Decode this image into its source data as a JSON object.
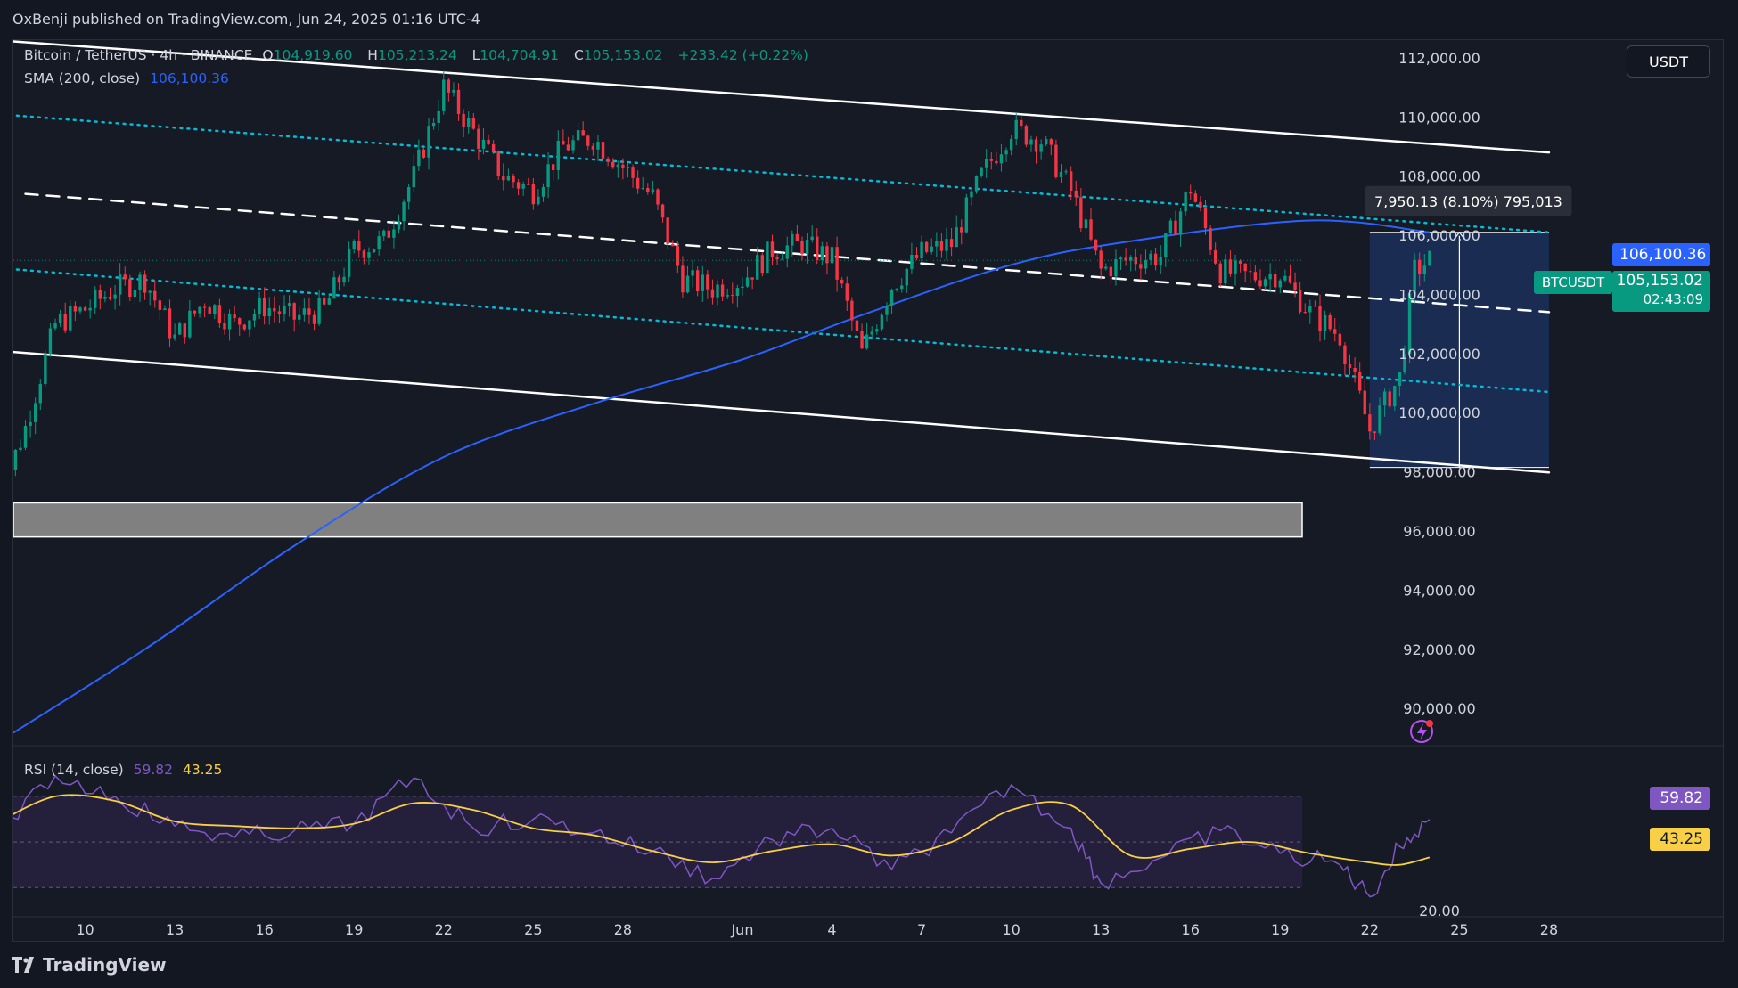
{
  "header": {
    "publisher": "OxBenji published on TradingView.com, Jun 24, 2025 01:16 UTC-4"
  },
  "legend": {
    "symbol": "Bitcoin / TetherUS · 4h · BINANCE",
    "o_label": "O",
    "o_value": "104,919.60",
    "h_label": "H",
    "h_value": "105,213.24",
    "l_label": "L",
    "l_value": "104,704.91",
    "c_label": "C",
    "c_value": "105,153.02",
    "change": "+233.42 (+0.22%)",
    "sma_label": "SMA (200, close)",
    "sma_value": "106,100.36"
  },
  "rsi_legend": {
    "label": "RSI (14, close)",
    "rsi_value": "59.82",
    "ma_value": "43.25"
  },
  "currency_button": "USDT",
  "price_tags": {
    "sma": "106,100.36",
    "symbol": "BTCUSDT",
    "last_price": "105,153.02",
    "countdown": "02:43:09",
    "rsi": "59.82",
    "rsi_ma": "43.25"
  },
  "measure": {
    "label": "7,950.13 (8.10%) 795,013"
  },
  "footer": {
    "brand": "TradingView"
  },
  "colors": {
    "up": "#089981",
    "down": "#f23645",
    "sma": "#2962ff",
    "rsi": "#7e57c2",
    "rsi_ma": "#f7d046",
    "channel": "#ffffff",
    "channel_dotted": "#00bcd4",
    "zone": "#8c8c8c",
    "measure_box": "#1f3c78"
  },
  "chart_data": {
    "type": "candlestick",
    "symbol": "Bitcoin / TetherUS",
    "timeframe": "4h",
    "exchange": "BINANCE",
    "y_axis": {
      "ylim": [
        88800,
        112600
      ],
      "ticks": [
        112000,
        110000,
        108000,
        106000,
        104000,
        102000,
        100000,
        98000,
        96000,
        94000,
        92000,
        90000
      ],
      "tick_labels": [
        "112,000.00",
        "110,000.00",
        "108,000.00",
        "106,000.00",
        "104,000.00",
        "102,000.00",
        "100,000.00",
        "98,000.00",
        "96,000.00",
        "94,000.00",
        "92,000.00",
        "90,000.00"
      ]
    },
    "x_axis": {
      "range": [
        "2025-05-07",
        "2025-06-30"
      ],
      "ticks": [
        "2025-05-10",
        "2025-05-13",
        "2025-05-16",
        "2025-05-19",
        "2025-05-22",
        "2025-05-25",
        "2025-05-28",
        "2025-06-01",
        "2025-06-04",
        "2025-06-07",
        "2025-06-10",
        "2025-06-13",
        "2025-06-16",
        "2025-06-19",
        "2025-06-22",
        "2025-06-25",
        "2025-06-28"
      ],
      "tick_labels": [
        "10",
        "13",
        "16",
        "19",
        "22",
        "25",
        "28",
        "Jun",
        "4",
        "7",
        "10",
        "13",
        "16",
        "19",
        "22",
        "25",
        "28"
      ]
    },
    "price_path": [
      [
        "2025-05-07T00:00",
        96800
      ],
      [
        "2025-05-08T00:00",
        99500
      ],
      [
        "2025-05-09T00:00",
        103000
      ],
      [
        "2025-05-10T00:00",
        103500
      ],
      [
        "2025-05-11T00:00",
        104200
      ],
      [
        "2025-05-12T00:00",
        104500
      ],
      [
        "2025-05-13T00:00",
        102500
      ],
      [
        "2025-05-14T00:00",
        103800
      ],
      [
        "2025-05-15T00:00",
        103000
      ],
      [
        "2025-05-16T00:00",
        103600
      ],
      [
        "2025-05-17T00:00",
        103200
      ],
      [
        "2025-05-18T00:00",
        103500
      ],
      [
        "2025-05-19T00:00",
        105500
      ],
      [
        "2025-05-20T00:00",
        105800
      ],
      [
        "2025-05-21T00:00",
        108000
      ],
      [
        "2025-05-22T00:00",
        111000
      ],
      [
        "2025-05-23T00:00",
        109500
      ],
      [
        "2025-05-24T00:00",
        108000
      ],
      [
        "2025-05-25T00:00",
        107500
      ],
      [
        "2025-05-26T00:00",
        109000
      ],
      [
        "2025-05-27T00:00",
        109300
      ],
      [
        "2025-05-28T00:00",
        108300
      ],
      [
        "2025-05-29T00:00",
        107300
      ],
      [
        "2025-05-30T00:00",
        104500
      ],
      [
        "2025-05-31T00:00",
        104200
      ],
      [
        "2025-06-01T00:00",
        104500
      ],
      [
        "2025-06-02T00:00",
        105500
      ],
      [
        "2025-06-03T00:00",
        105700
      ],
      [
        "2025-06-04T00:00",
        105200
      ],
      [
        "2025-06-05T00:00",
        102000
      ],
      [
        "2025-06-06T00:00",
        104300
      ],
      [
        "2025-06-07T00:00",
        105400
      ],
      [
        "2025-06-08T00:00",
        105700
      ],
      [
        "2025-06-09T00:00",
        108000
      ],
      [
        "2025-06-10T00:00",
        109600
      ],
      [
        "2025-06-11T00:00",
        109200
      ],
      [
        "2025-06-12T00:00",
        107500
      ],
      [
        "2025-06-13T00:00",
        104800
      ],
      [
        "2025-06-14T00:00",
        105200
      ],
      [
        "2025-06-15T00:00",
        105300
      ],
      [
        "2025-06-16T00:00",
        107600
      ],
      [
        "2025-06-17T00:00",
        104800
      ],
      [
        "2025-06-18T00:00",
        104600
      ],
      [
        "2025-06-19T00:00",
        104700
      ],
      [
        "2025-06-20T00:00",
        103400
      ],
      [
        "2025-06-21T00:00",
        102600
      ],
      [
        "2025-06-22T00:00",
        99400
      ],
      [
        "2025-06-23T00:00",
        101200
      ],
      [
        "2025-06-23T12:00",
        104800
      ],
      [
        "2025-06-24T00:00",
        105153
      ]
    ],
    "sma_200": [
      [
        "2025-05-07T00:00",
        88800
      ],
      [
        "2025-05-12T00:00",
        92000
      ],
      [
        "2025-05-17T00:00",
        95500
      ],
      [
        "2025-05-22T00:00",
        98500
      ],
      [
        "2025-05-27T00:00",
        100300
      ],
      [
        "2025-06-01T00:00",
        101800
      ],
      [
        "2025-06-05T00:00",
        103300
      ],
      [
        "2025-06-10T00:00",
        105000
      ],
      [
        "2025-06-14T00:00",
        105800
      ],
      [
        "2025-06-20T00:00",
        106500
      ],
      [
        "2025-06-24T00:00",
        106100
      ]
    ],
    "descending_channel": {
      "upper": [
        [
          "2025-05-07",
          112600
        ],
        [
          "2025-06-28",
          108800
        ]
      ],
      "lower": [
        [
          "2025-05-07",
          102100
        ],
        [
          "2025-06-28",
          97980
        ]
      ],
      "mid_dashed": [
        [
          "2025-05-08",
          107400
        ],
        [
          "2025-06-28",
          103400
        ]
      ],
      "upper_quarter_dotted": [
        [
          "2025-05-07",
          110100
        ],
        [
          "2025-06-28",
          106100
        ]
      ],
      "lower_quarter_dotted": [
        [
          "2025-05-07",
          104900
        ],
        [
          "2025-06-28",
          100700
        ]
      ]
    },
    "support_zone": [
      95800,
      96950
    ],
    "measure": {
      "from_price": 98150,
      "to_price": 106100,
      "from_date": "2025-06-22",
      "to_date": "2025-06-28",
      "change": 7950.13,
      "percent": 8.1
    },
    "last_price": 105153.02,
    "rsi_panel": {
      "ylim": [
        18,
        93
      ],
      "levels": [
        70,
        50,
        30
      ],
      "tick_labels": [
        "20.00"
      ],
      "rsi_path": [
        [
          "2025-05-07",
          52
        ],
        [
          "2025-05-09",
          79
        ],
        [
          "2025-05-11",
          70
        ],
        [
          "2025-05-13",
          57
        ],
        [
          "2025-05-15",
          52
        ],
        [
          "2025-05-17",
          55
        ],
        [
          "2025-05-19",
          58
        ],
        [
          "2025-05-21",
          78
        ],
        [
          "2025-05-23",
          56
        ],
        [
          "2025-05-25",
          60
        ],
        [
          "2025-05-27",
          54
        ],
        [
          "2025-05-29",
          46
        ],
        [
          "2025-05-31",
          34
        ],
        [
          "2025-06-02",
          51
        ],
        [
          "2025-06-04",
          56
        ],
        [
          "2025-06-06",
          38
        ],
        [
          "2025-06-08",
          54
        ],
        [
          "2025-06-10",
          75
        ],
        [
          "2025-06-12",
          56
        ],
        [
          "2025-06-13",
          32
        ],
        [
          "2025-06-15",
          43
        ],
        [
          "2025-06-17",
          55
        ],
        [
          "2025-06-19",
          45
        ],
        [
          "2025-06-21",
          40
        ],
        [
          "2025-06-22",
          26
        ],
        [
          "2025-06-23",
          48
        ],
        [
          "2025-06-24",
          59.82
        ]
      ],
      "rsi_ma_path": [
        [
          "2025-05-07",
          58
        ],
        [
          "2025-05-09",
          70
        ],
        [
          "2025-05-11",
          68
        ],
        [
          "2025-05-13",
          59
        ],
        [
          "2025-05-15",
          57
        ],
        [
          "2025-05-17",
          56
        ],
        [
          "2025-05-19",
          58
        ],
        [
          "2025-05-21",
          67
        ],
        [
          "2025-05-23",
          64
        ],
        [
          "2025-05-25",
          56
        ],
        [
          "2025-05-27",
          53
        ],
        [
          "2025-05-29",
          46
        ],
        [
          "2025-05-31",
          41
        ],
        [
          "2025-06-02",
          46
        ],
        [
          "2025-06-04",
          49
        ],
        [
          "2025-06-06",
          44
        ],
        [
          "2025-06-08",
          50
        ],
        [
          "2025-06-10",
          64
        ],
        [
          "2025-06-12",
          66
        ],
        [
          "2025-06-14",
          44
        ],
        [
          "2025-06-16",
          47
        ],
        [
          "2025-06-18",
          50
        ],
        [
          "2025-06-20",
          45
        ],
        [
          "2025-06-22",
          41
        ],
        [
          "2025-06-23",
          40
        ],
        [
          "2025-06-24",
          43.25
        ]
      ]
    }
  }
}
